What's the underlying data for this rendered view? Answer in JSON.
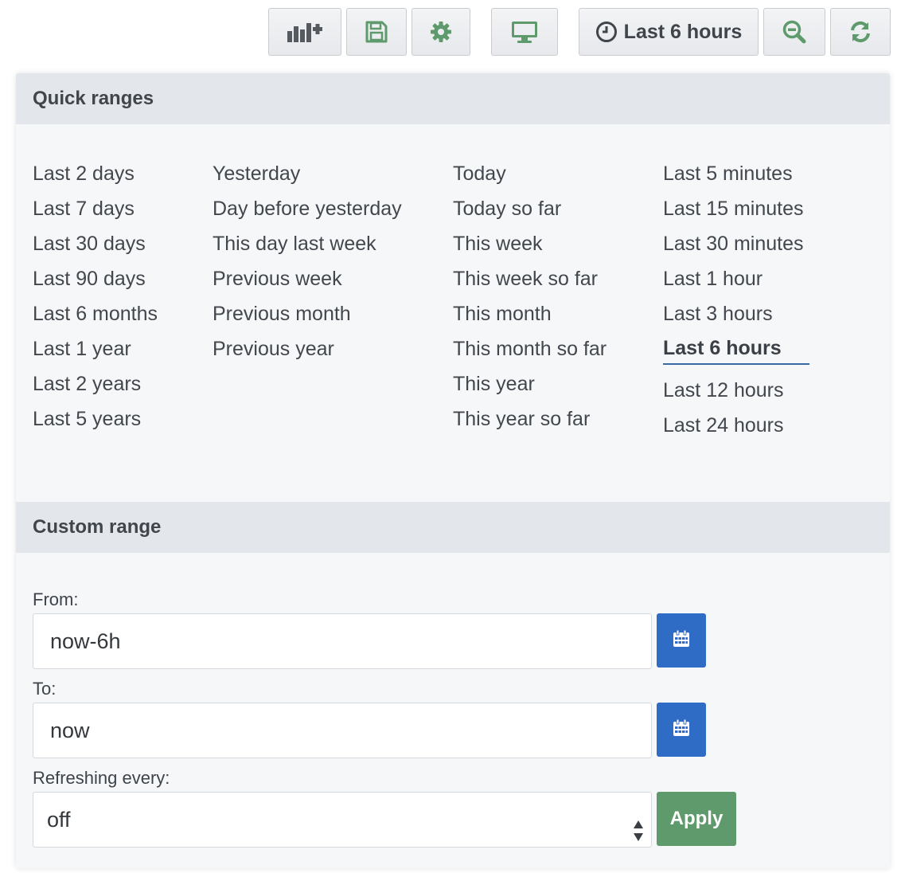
{
  "toolbar": {
    "add_panel_icon": "bar-chart-plus-icon",
    "save_icon": "floppy-disk-icon",
    "settings_icon": "gear-icon",
    "view_mode_icon": "monitor-icon",
    "time_picker_label": "Last 6 hours",
    "zoom_out_icon": "zoom-out-icon",
    "refresh_icon": "refresh-icon"
  },
  "quick_ranges": {
    "heading": "Quick ranges",
    "col1": [
      "Last 2 days",
      "Last 7 days",
      "Last 30 days",
      "Last 90 days",
      "Last 6 months",
      "Last 1 year",
      "Last 2 years",
      "Last 5 years"
    ],
    "col2": [
      "Yesterday",
      "Day before yesterday",
      "This day last week",
      "Previous week",
      "Previous month",
      "Previous year"
    ],
    "col3": [
      "Today",
      "Today so far",
      "This week",
      "This week so far",
      "This month",
      "This month so far",
      "This year",
      "This year so far"
    ],
    "col4": [
      "Last 5 minutes",
      "Last 15 minutes",
      "Last 30 minutes",
      "Last 1 hour",
      "Last 3 hours",
      "Last 6 hours",
      "Last 12 hours",
      "Last 24 hours"
    ],
    "selected": "Last 6 hours"
  },
  "custom_range": {
    "heading": "Custom range",
    "from_label": "From:",
    "from_value": "now-6h",
    "to_label": "To:",
    "to_value": "now",
    "refresh_label": "Refreshing every:",
    "refresh_value": "off",
    "calendar_icon": "calendar-icon",
    "apply_label": "Apply"
  },
  "colors": {
    "calendar_button": "#2f6cc6",
    "apply_button": "#5e9a6b",
    "active_underline": "#3a6aa6",
    "header_bg": "#e3e6ea"
  }
}
